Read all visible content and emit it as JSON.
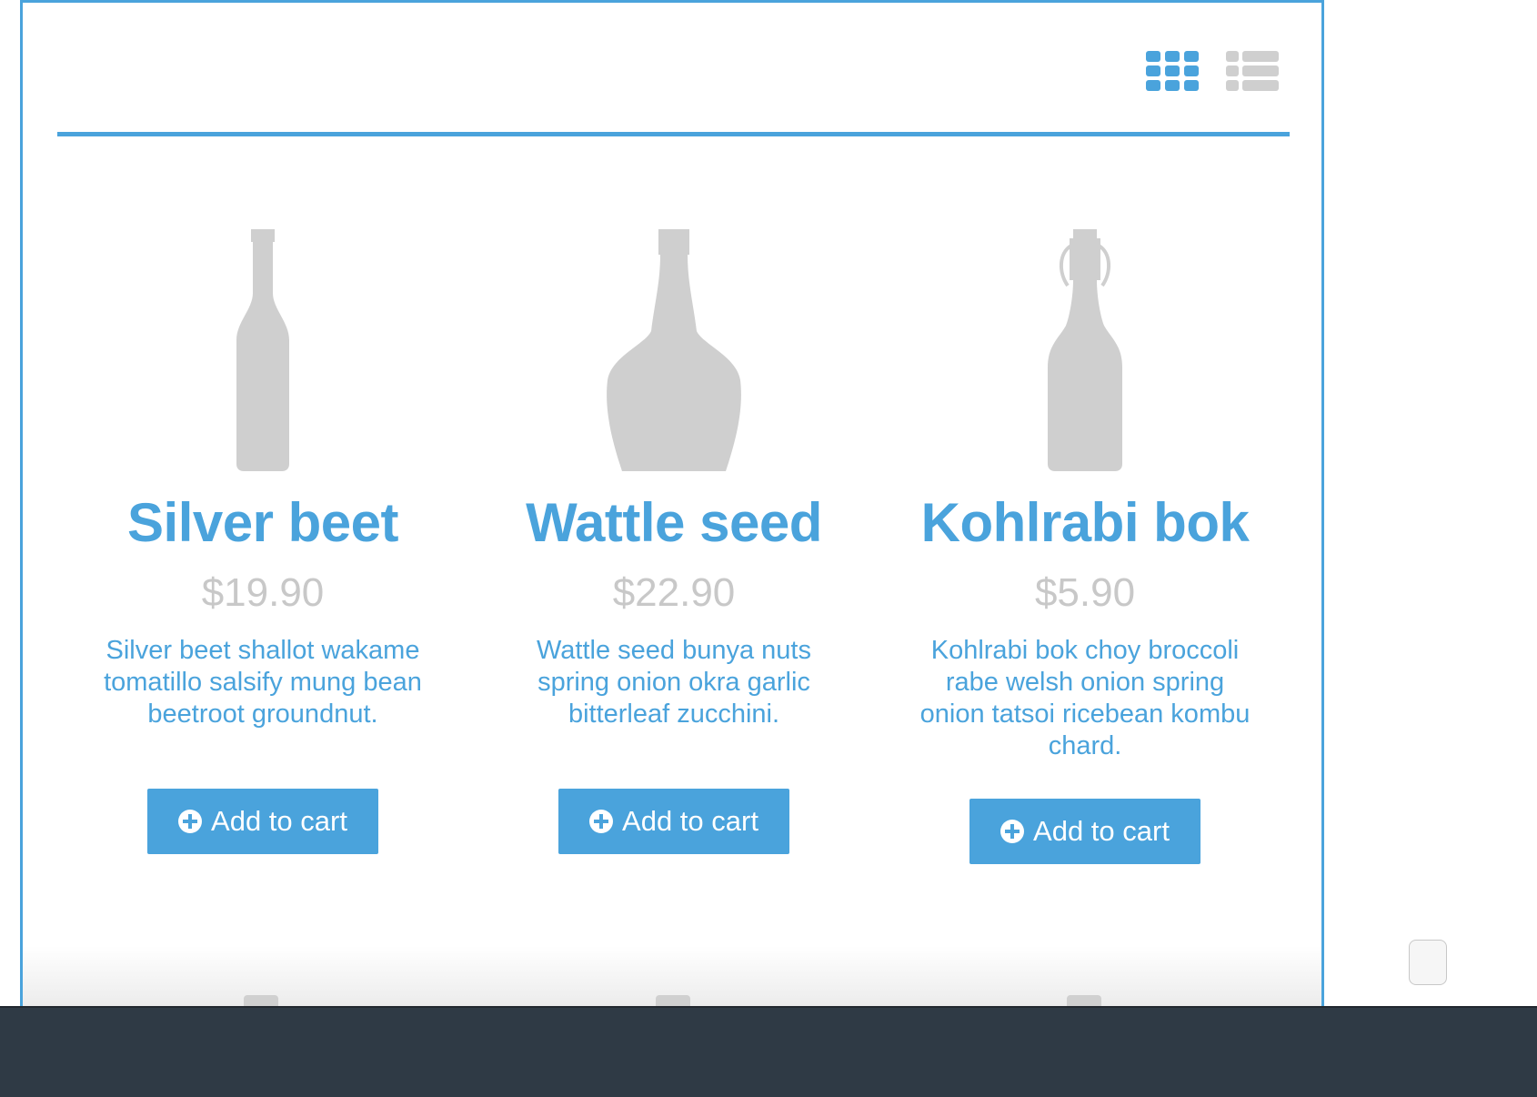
{
  "toolbar": {
    "grid_view_icon": "grid-view-icon",
    "list_view_icon": "list-view-icon",
    "active_view": "grid"
  },
  "colors": {
    "accent": "#4aa3dc",
    "muted": "#c8c8c8"
  },
  "products": [
    {
      "name": "Silver beet",
      "price": "$19.90",
      "description": "Silver beet shallot wakame tomatillo salsify mung bean beetroot groundnut.",
      "button_label": "Add to cart",
      "image_icon": "wine-bottle-icon"
    },
    {
      "name": "Wattle seed",
      "price": "$22.90",
      "description": "Wattle seed bunya nuts spring onion okra garlic bitterleaf zucchini.",
      "button_label": "Add to cart",
      "image_icon": "liquor-bottle-icon"
    },
    {
      "name": "Kohlrabi bok",
      "price": "$5.90",
      "description": "Kohlrabi bok choy broccoli rabe welsh onion spring onion tatsoi ricebean kombu chard.",
      "button_label": "Add to cart",
      "image_icon": "swing-top-bottle-icon"
    }
  ]
}
